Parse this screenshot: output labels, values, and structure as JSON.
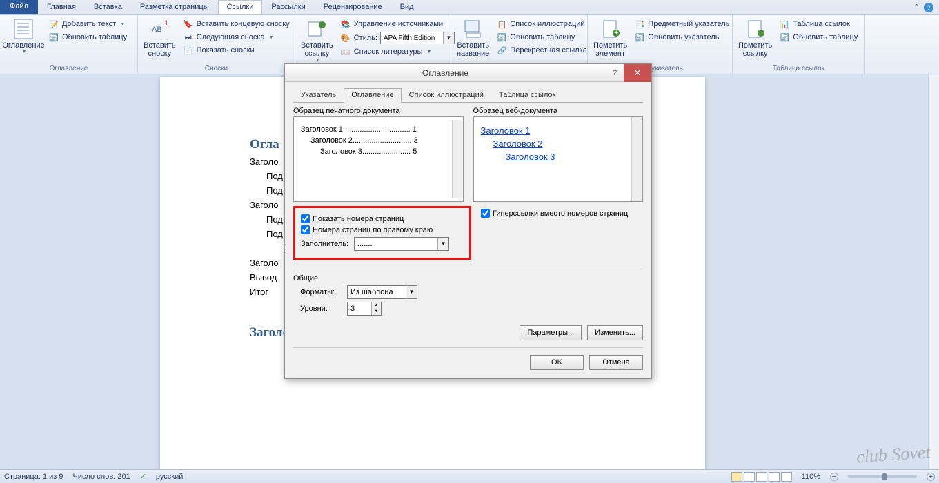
{
  "menu": {
    "file": "Файл",
    "tabs": [
      "Главная",
      "Вставка",
      "Разметка страницы",
      "Ссылки",
      "Рассылки",
      "Рецензирование",
      "Вид"
    ],
    "active": 3
  },
  "ribbon": {
    "g1": {
      "label": "Оглавление",
      "big": "Оглавление",
      "add_text": "Добавить текст",
      "update": "Обновить таблицу"
    },
    "g2": {
      "label": "Сноски",
      "big": "Вставить сноску",
      "endnote": "Вставить концевую сноску",
      "next": "Следующая сноска",
      "show": "Показать сноски"
    },
    "g3": {
      "label": "",
      "big": "Вставить ссылку",
      "manage": "Управление источниками",
      "style_label": "Стиль:",
      "style_value": "APA Fifth Edition",
      "biblio": "Список литературы"
    },
    "g4": {
      "label": "",
      "big": "Вставить название",
      "list": "Список иллюстраций",
      "update": "Обновить таблицу",
      "cross": "Перекрестная ссылка"
    },
    "g5": {
      "label": "ный указатель",
      "big": "Пометить элемент",
      "index": "Предметный указатель",
      "update": "Обновить указатель"
    },
    "g6": {
      "label": "Таблица ссылок",
      "big": "Пометить ссылку",
      "table": "Таблица ссылок",
      "update": "Обновить таблицу"
    }
  },
  "doc": {
    "title": "Огла",
    "h2": "Заголовок",
    "lines": [
      "Заголо",
      "Под",
      "Под",
      "Заголо",
      "Под",
      "Под",
      "По",
      "Заголо",
      "Вывод",
      "Итог"
    ]
  },
  "dialog": {
    "title": "Оглавление",
    "tabs": [
      "Указатель",
      "Оглавление",
      "Список иллюстраций",
      "Таблица ссылок"
    ],
    "active": 1,
    "print_label": "Образец печатного документа",
    "web_label": "Образец веб-документа",
    "print_lines": [
      "Заголовок 1 ............................... 1",
      "Заголовок 2............................ 3",
      "Заголовок 3....................... 5"
    ],
    "web_lines": [
      "Заголовок 1",
      "Заголовок 2",
      "Заголовок 3"
    ],
    "opt_show_pages": "Показать номера страниц",
    "opt_right_align": "Номера страниц по правому краю",
    "opt_hyperlinks": "Гиперссылки вместо номеров страниц",
    "filler_label": "Заполнитель:",
    "filler_value": ".......",
    "general": "Общие",
    "formats_label": "Форматы:",
    "formats_value": "Из шаблона",
    "levels_label": "Уровни:",
    "levels_value": "3",
    "params": "Параметры...",
    "modify": "Изменить...",
    "ok": "OK",
    "cancel": "Отмена"
  },
  "status": {
    "page": "Страница: 1 из 9",
    "words": "Число слов: 201",
    "lang": "русский",
    "zoom": "110%"
  },
  "watermark": "club Sovet"
}
